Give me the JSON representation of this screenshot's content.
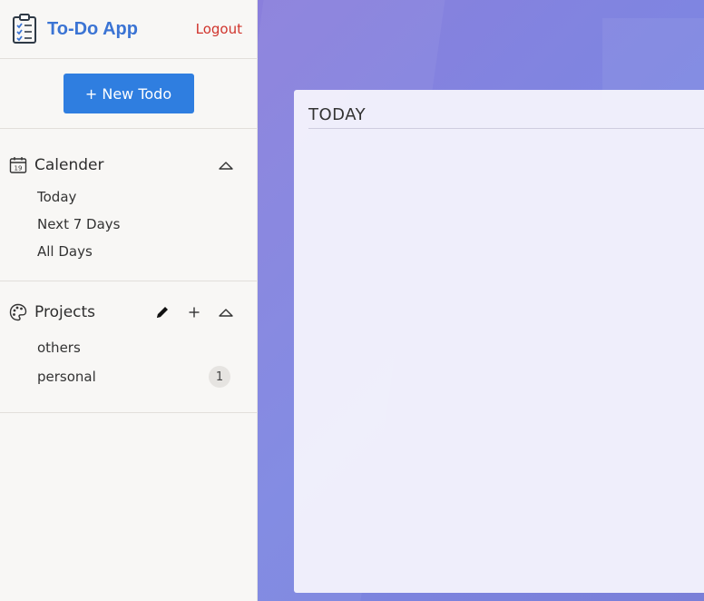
{
  "app": {
    "title": "To-Do App",
    "logout_label": "Logout"
  },
  "actions": {
    "new_todo_label": "+ New Todo"
  },
  "calendar": {
    "title": "Calender",
    "icon_day": "19",
    "items": [
      {
        "label": "Today"
      },
      {
        "label": "Next 7 Days"
      },
      {
        "label": "All Days"
      }
    ]
  },
  "projects": {
    "title": "Projects",
    "items": [
      {
        "label": "others",
        "count": ""
      },
      {
        "label": "personal",
        "count": "1"
      }
    ]
  },
  "main": {
    "panel_title": "TODAY"
  },
  "colors": {
    "accent": "#2f7ee0",
    "title": "#3b74d4",
    "logout": "#d0342c",
    "background_gradient_start": "#8a7fdc",
    "background_gradient_end": "#7a7fd8"
  },
  "icons": {
    "logo": "clipboard-checklist-icon",
    "calendar": "calendar-icon",
    "projects": "palette-icon",
    "edit": "pencil-icon",
    "add": "plus-icon",
    "collapse": "chevron-up-icon"
  }
}
